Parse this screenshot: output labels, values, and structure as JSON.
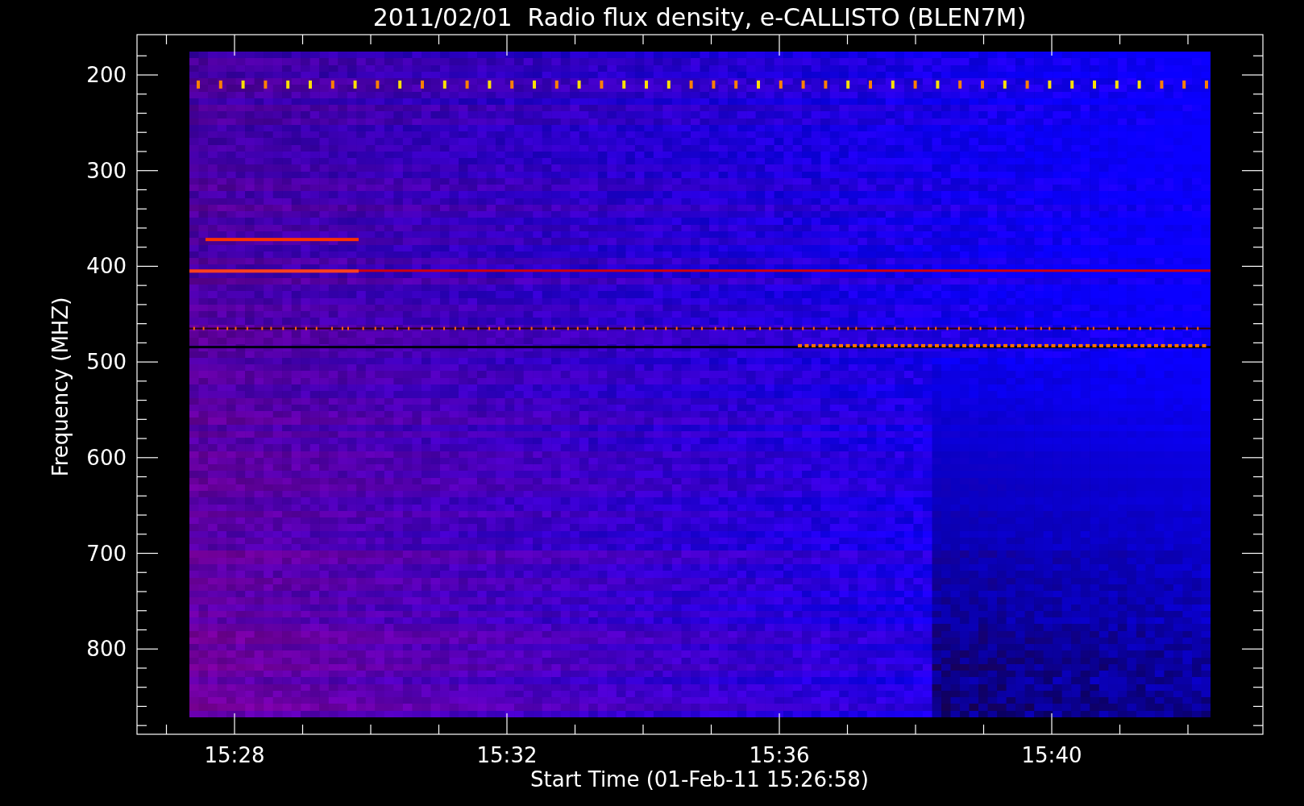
{
  "plot": {
    "title": "2011/02/01  Radio flux density, e-CALLISTO (BLEN7M)",
    "ylabel": "Frequency (MHZ)",
    "xlabel": "Start Time (01-Feb-11 15:26:58)",
    "yticks": [
      "200",
      "300",
      "400",
      "500",
      "600",
      "700",
      "800"
    ],
    "xticks": [
      "15:28",
      "15:32",
      "15:36",
      "15:40"
    ]
  }
}
